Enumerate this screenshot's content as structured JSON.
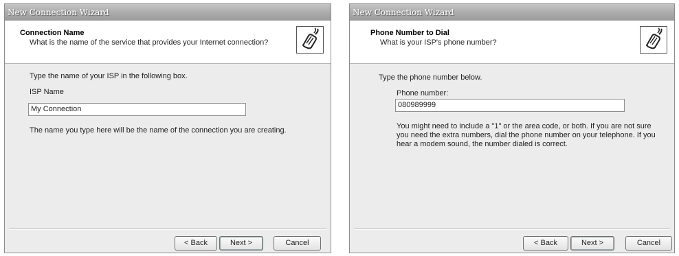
{
  "left": {
    "title": "New Connection Wizard",
    "header_title": "Connection Name",
    "header_subtitle": "What is the name of the service that provides your Internet connection?",
    "instruction": "Type the name of your ISP in the following box.",
    "field_label": "ISP Name",
    "field_value": "My Connection",
    "note": "The name you type here will be the name of the connection you are creating.",
    "back_label": "< Back",
    "next_label": "Next >",
    "cancel_label": "Cancel"
  },
  "right": {
    "title": "New Connection Wizard",
    "header_title": "Phone Number to Dial",
    "header_subtitle": "What is your ISP's phone number?",
    "instruction": "Type the phone number below.",
    "field_label": "Phone number:",
    "field_value": "080989999",
    "note_line1": "You might need to include a \"1\" or the area code, or both. If you are not sure",
    "note_line2": "you need the extra numbers, dial the phone number on your telephone. If you",
    "note_line3": "hear a modem sound, the number dialed is correct.",
    "back_label": "< Back",
    "next_label": "Next >",
    "cancel_label": "Cancel"
  },
  "icons": {
    "wizard": "phone-connector-icon"
  }
}
